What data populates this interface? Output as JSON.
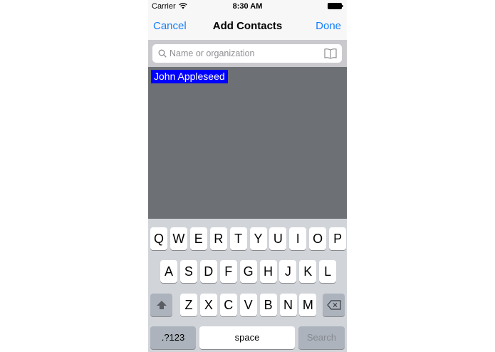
{
  "status_bar": {
    "carrier": "Carrier",
    "time": "8:30 AM"
  },
  "nav": {
    "cancel_label": "Cancel",
    "title": "Add Contacts",
    "done_label": "Done"
  },
  "search": {
    "placeholder": "Name or organization",
    "value": ""
  },
  "results": {
    "items": [
      {
        "label": "John Appleseed",
        "selected": true
      }
    ]
  },
  "keyboard": {
    "row1": [
      "Q",
      "W",
      "E",
      "R",
      "T",
      "Y",
      "U",
      "I",
      "O",
      "P"
    ],
    "row2": [
      "A",
      "S",
      "D",
      "F",
      "G",
      "H",
      "J",
      "K",
      "L"
    ],
    "row3": [
      "Z",
      "X",
      "C",
      "V",
      "B",
      "N",
      "M"
    ],
    "numbers_label": ".?123",
    "space_label": "space",
    "search_label": "Search"
  },
  "colors": {
    "accent": "#157efb",
    "results_bg": "#6d7075",
    "selection": "#0000ff",
    "keyboard_bg": "#d1d4d9"
  }
}
